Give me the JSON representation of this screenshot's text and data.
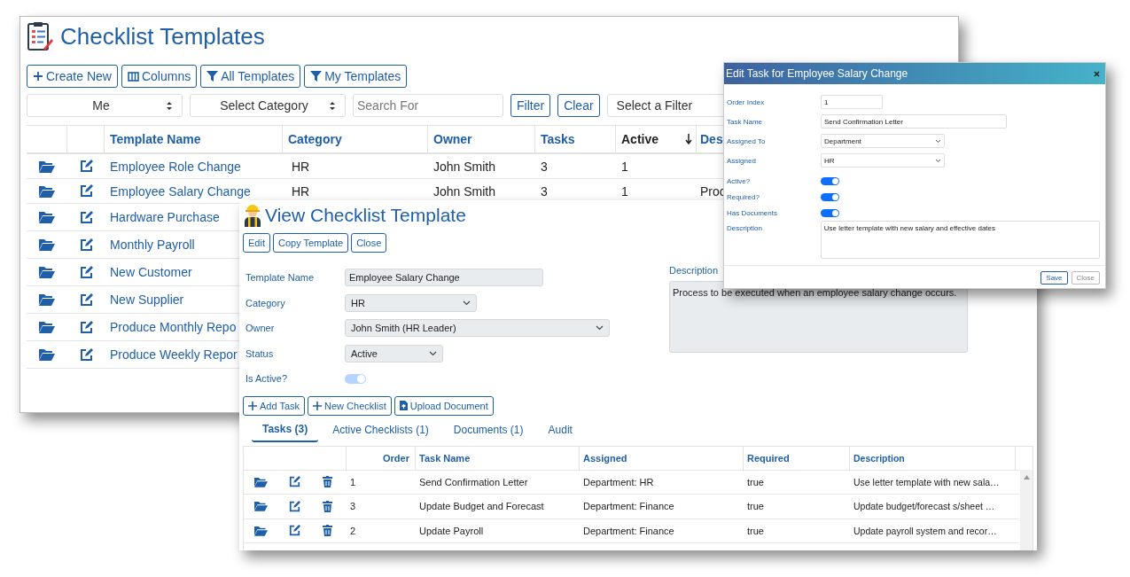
{
  "list_window": {
    "title": "Checklist Templates",
    "toolbar": [
      "Create New",
      "Columns",
      "All Templates",
      "My Templates"
    ],
    "filters": {
      "owner": "Me",
      "category": "Select Category",
      "search_placeholder": "Search For",
      "buttons": [
        "Filter",
        "Clear"
      ],
      "saved_filter": "Select a Filter"
    },
    "table": {
      "columns": [
        {
          "label": "Template Name",
          "sorted": false
        },
        {
          "label": "Category",
          "sorted": false
        },
        {
          "label": "Owner",
          "sorted": false
        },
        {
          "label": "Tasks",
          "sorted": false
        },
        {
          "label": "Active",
          "sorted": true
        },
        {
          "label": "Des",
          "sorted": false
        }
      ],
      "rows": [
        {
          "name": "Employee Role Change",
          "category": "HR",
          "owner": "John Smith",
          "tasks": "3",
          "active": "1"
        },
        {
          "name": "Employee Salary Change",
          "category": "HR",
          "owner": "John Smith",
          "tasks": "3",
          "active": "1",
          "description": "Proc"
        },
        {
          "name": "Hardware Purchase"
        },
        {
          "name": "Monthly Payroll"
        },
        {
          "name": "New Customer"
        },
        {
          "name": "New Supplier"
        },
        {
          "name": "Produce Monthly Repo"
        },
        {
          "name": "Produce Weekly Repor"
        }
      ]
    }
  },
  "view_window": {
    "title": "View Checklist Template",
    "buttons": [
      "Edit",
      "Copy Template",
      "Close"
    ],
    "fields": [
      {
        "label": "Template Name",
        "kind": "input",
        "value": "Employee Salary Change"
      },
      {
        "label": "Category",
        "kind": "select",
        "value": "HR"
      },
      {
        "label": "Owner",
        "kind": "select",
        "value": "John Smith (HR Leader)"
      },
      {
        "label": "Status",
        "kind": "select",
        "value": "Active"
      },
      {
        "label": "Is Active?",
        "kind": "toggle",
        "on": true,
        "disabled": true
      }
    ],
    "description": {
      "label": "Description",
      "value": "Process to be executed when an employee salary change occurs."
    },
    "actions": [
      "Add Task",
      "New Checklist",
      "Upload Document"
    ],
    "tabs": [
      {
        "label": "Tasks (3)",
        "selected": true
      },
      {
        "label": "Active Checklists (1)",
        "selected": false
      },
      {
        "label": "Documents (1)",
        "selected": false
      },
      {
        "label": "Audit",
        "selected": false
      }
    ],
    "tasks": {
      "columns": [
        "Order",
        "Task Name",
        "Assigned",
        "Required",
        "Description"
      ],
      "rows": [
        {
          "order": "1",
          "name": "Send Confirmation Letter",
          "assigned": "Department: HR",
          "required": "true",
          "description": "Use letter template with new sala…"
        },
        {
          "order": "3",
          "name": "Update Budget and Forecast",
          "assigned": "Department: Finance",
          "required": "true",
          "description": "Update budget/forecast s/sheet …"
        },
        {
          "order": "2",
          "name": "Update Payroll",
          "assigned": "Department: Finance",
          "required": "true",
          "description": "Update payroll system and recor…"
        }
      ]
    }
  },
  "dialog": {
    "title": "Edit Task for Employee Salary Change",
    "fields": [
      {
        "label": "Order Index",
        "kind": "input",
        "value": "1"
      },
      {
        "label": "Task Name",
        "kind": "input",
        "value": "Send Confirmation Letter"
      },
      {
        "label": "Assigned To",
        "kind": "select",
        "value": "Department"
      },
      {
        "label": "Assigned",
        "kind": "select",
        "value": "HR"
      },
      {
        "label": "Active?",
        "kind": "toggle",
        "on": true
      },
      {
        "label": "Required?",
        "kind": "toggle",
        "on": true
      },
      {
        "label": "Has Documents",
        "kind": "toggle",
        "on": true
      },
      {
        "label": "Description",
        "kind": "textarea",
        "value": "Use letter template with new salary and effective dates"
      }
    ],
    "buttons": [
      {
        "label": "Save",
        "primary": true
      },
      {
        "label": "Close",
        "primary": false
      }
    ]
  }
}
